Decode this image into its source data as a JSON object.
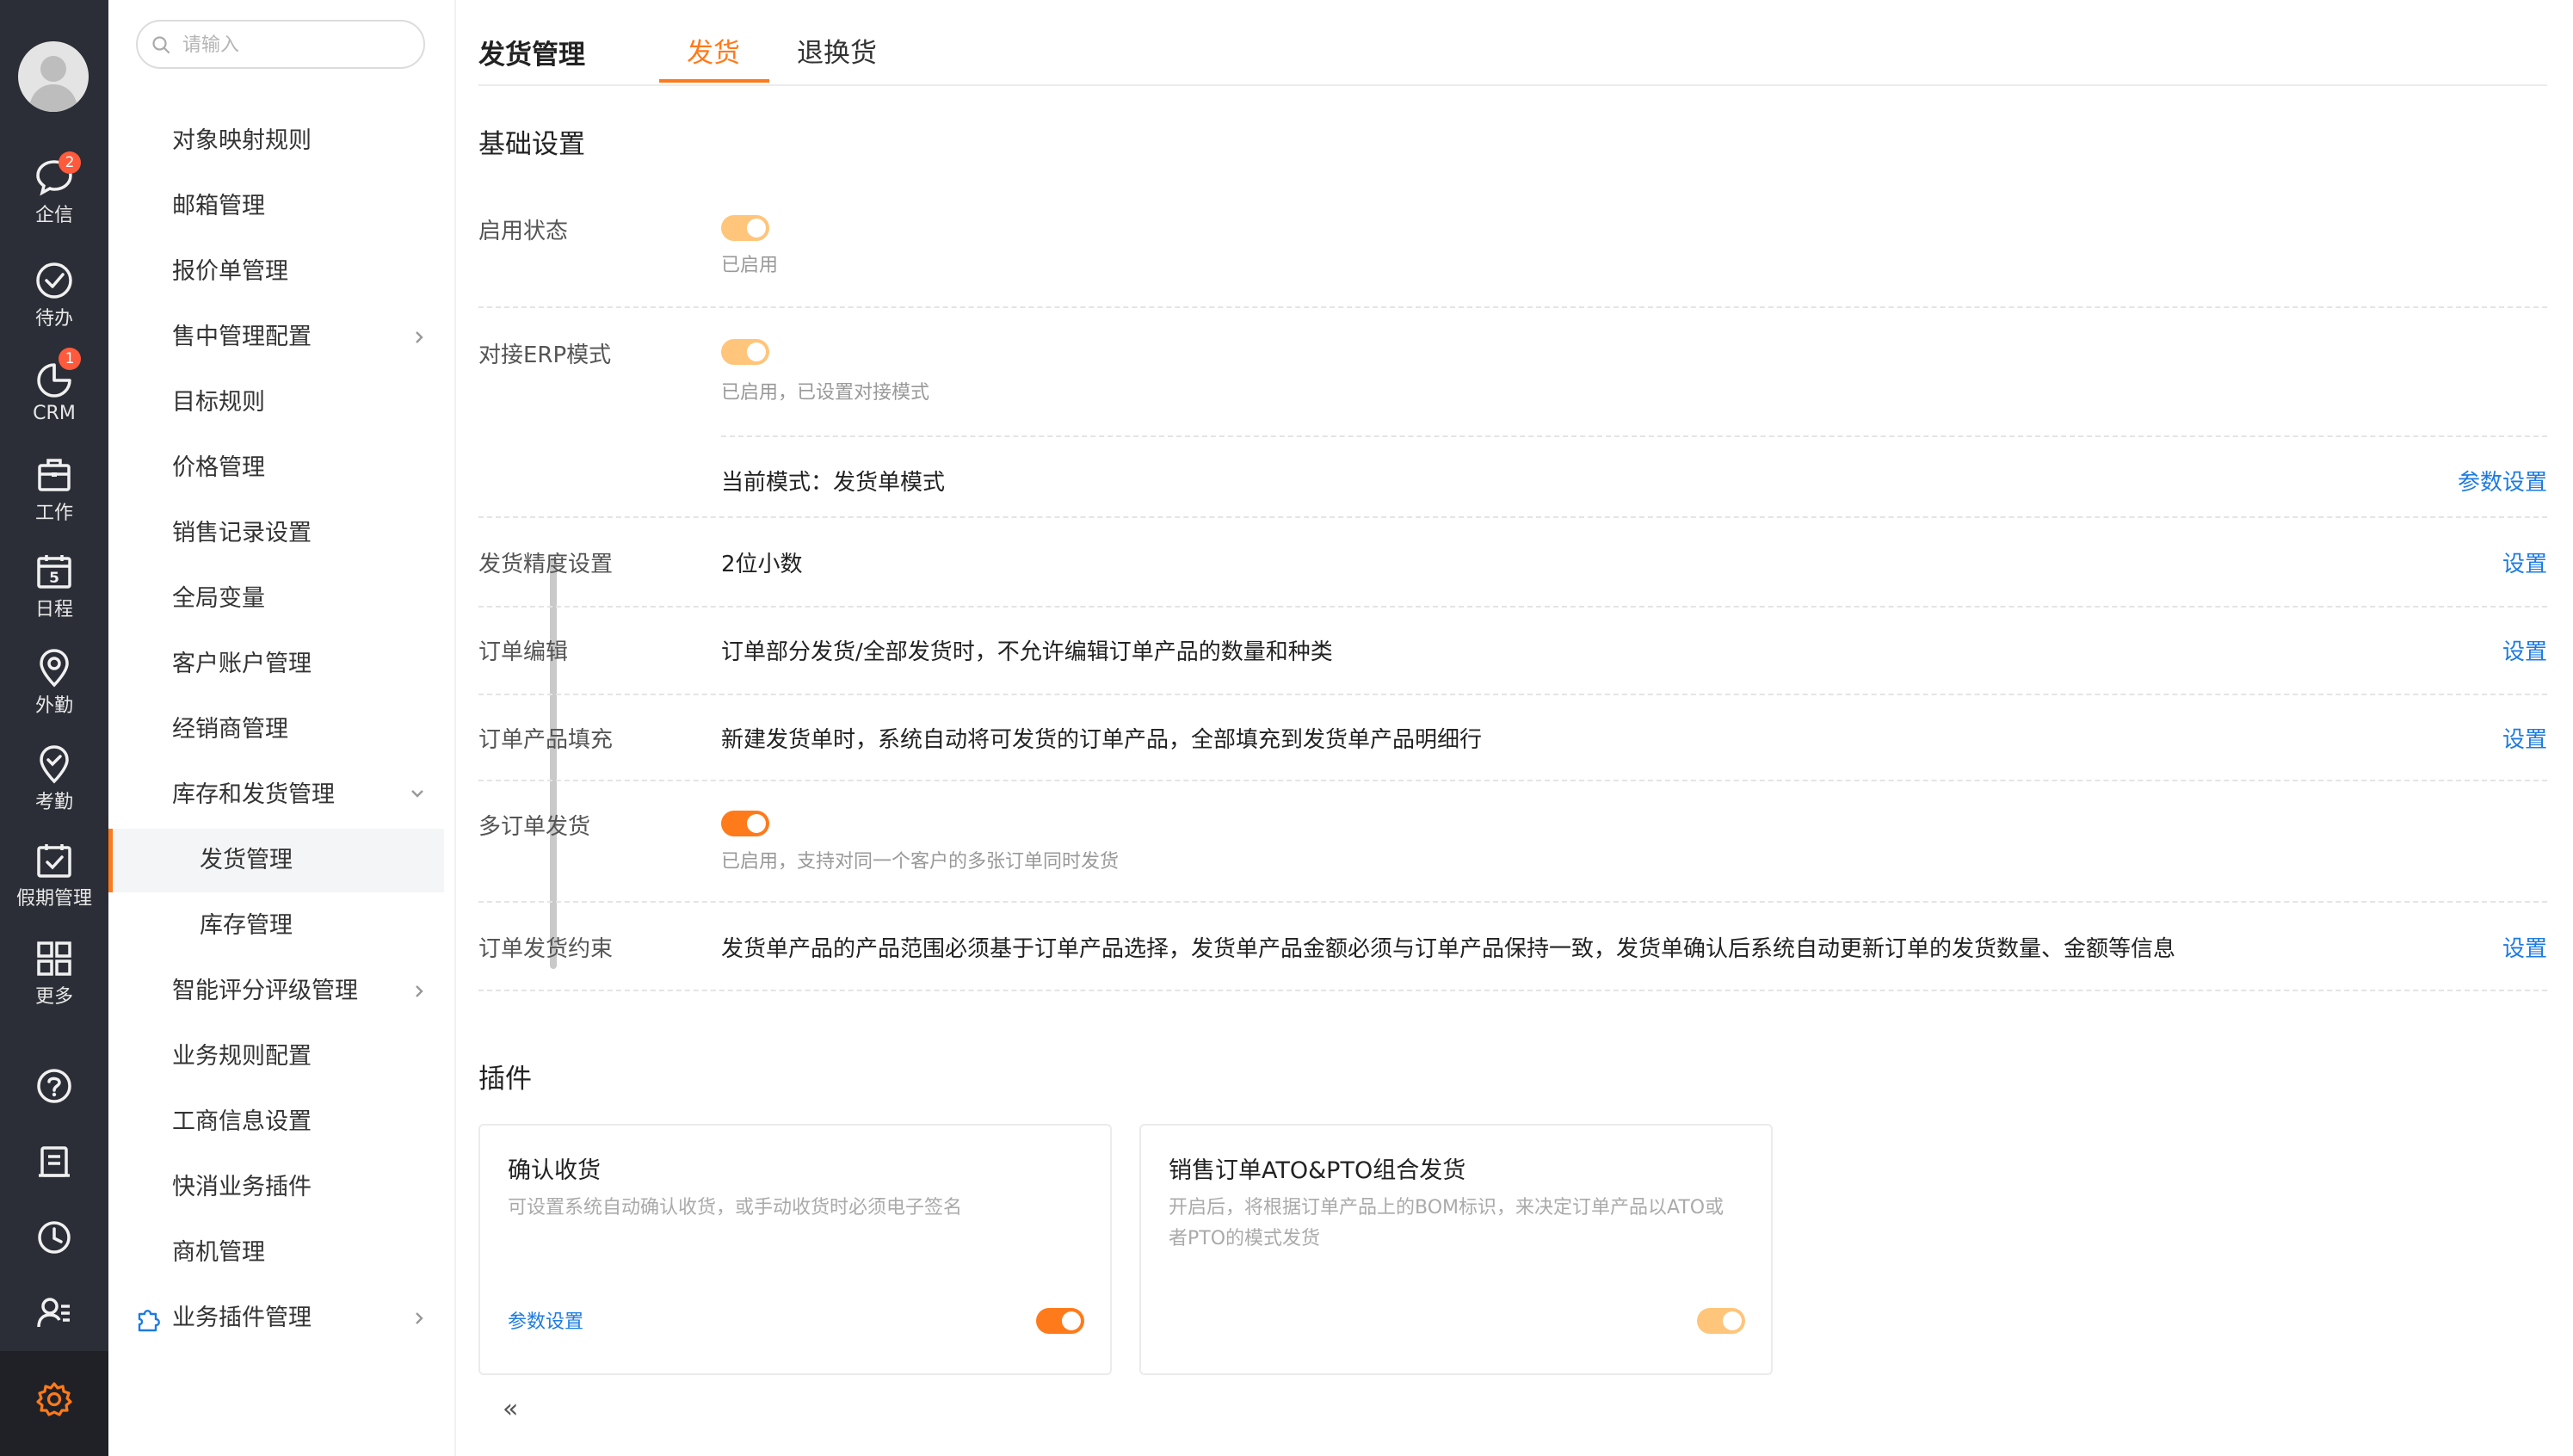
{
  "rail": {
    "items": [
      {
        "label": "企信",
        "badge": "2",
        "icon": "chat-icon"
      },
      {
        "label": "待办",
        "badge": "",
        "icon": "check-circle-icon"
      },
      {
        "label": "CRM",
        "badge": "1",
        "icon": "pie-chart-icon"
      },
      {
        "label": "工作",
        "badge": "",
        "icon": "briefcase-icon"
      },
      {
        "label": "日程",
        "badge": "",
        "icon": "calendar-icon",
        "day": "5"
      },
      {
        "label": "外勤",
        "badge": "",
        "icon": "location-pin-icon"
      },
      {
        "label": "考勤",
        "badge": "",
        "icon": "attendance-icon"
      },
      {
        "label": "假期管理",
        "badge": "",
        "icon": "leave-calendar-icon"
      },
      {
        "label": "更多",
        "badge": "",
        "icon": "grid-icon"
      }
    ],
    "bottom_icons": [
      "help-icon",
      "notebook-icon",
      "clock-icon",
      "user-list-icon"
    ],
    "settings_icon": "gear-icon",
    "accent": "#ff7a1a"
  },
  "menu": {
    "search_placeholder": "请输入",
    "items": [
      {
        "label": "对象映射规则"
      },
      {
        "label": "邮箱管理"
      },
      {
        "label": "报价单管理"
      },
      {
        "label": "售中管理配置",
        "arrow": "right"
      },
      {
        "label": "目标规则"
      },
      {
        "label": "价格管理"
      },
      {
        "label": "销售记录设置"
      },
      {
        "label": "全局变量"
      },
      {
        "label": "客户账户管理"
      },
      {
        "label": "经销商管理"
      },
      {
        "label": "库存和发货管理",
        "arrow": "down"
      },
      {
        "label": "发货管理",
        "sub": true,
        "active": true
      },
      {
        "label": "库存管理",
        "sub": true
      },
      {
        "label": "智能评分评级管理",
        "arrow": "right"
      },
      {
        "label": "业务规则配置"
      },
      {
        "label": "工商信息设置"
      },
      {
        "label": "快消业务插件"
      },
      {
        "label": "商机管理"
      },
      {
        "label": "业务插件管理",
        "arrow": "right",
        "icon": "puzzle-icon"
      }
    ],
    "collapse_label": "«"
  },
  "header": {
    "title": "发货管理",
    "tabs": [
      {
        "label": "发货",
        "active": true
      },
      {
        "label": "退换货",
        "active": false
      }
    ]
  },
  "basic": {
    "title": "基础设置",
    "enable": {
      "label": "启用状态",
      "status": "已启用",
      "on": true
    },
    "erp": {
      "label": "对接ERP模式",
      "status": "已启用，已设置对接模式",
      "on": true,
      "mode_text": "当前模式：发货单模式",
      "link": "参数设置"
    },
    "precision": {
      "label": "发货精度设置",
      "value": "2位小数",
      "link": "设置"
    },
    "order_edit": {
      "label": "订单编辑",
      "value": "订单部分发货/全部发货时，不允许编辑订单产品的数量和种类",
      "link": "设置"
    },
    "order_fill": {
      "label": "订单产品填充",
      "value": "新建发货单时，系统自动将可发货的订单产品，全部填充到发货单产品明细行",
      "link": "设置"
    },
    "multi_order": {
      "label": "多订单发货",
      "status": "已启用，支持对同一个客户的多张订单同时发货",
      "on": true
    },
    "constraint": {
      "label": "订单发货约束",
      "value": "发货单产品的产品范围必须基于订单产品选择，发货单产品金额必须与订单产品保持一致，发货单确认后系统自动更新订单的发货数量、金额等信息",
      "link": "设置"
    }
  },
  "plugins": {
    "title": "插件",
    "cards": [
      {
        "title": "确认收货",
        "desc": "可设置系统自动确认收货，或手动收货时必须电子签名",
        "link": "参数设置",
        "on": true
      },
      {
        "title": "销售订单ATO&PTO组合发货",
        "desc": "开启后，将根据订单产品上的BOM标识，来决定订单产品以ATO或者PTO的模式发货",
        "link": "",
        "on": true
      }
    ]
  },
  "colors": {
    "accent": "#ff7a1a",
    "toggle_light": "#ffc57a",
    "link": "#1e7be0",
    "rail_bg": "#2b2e36"
  }
}
